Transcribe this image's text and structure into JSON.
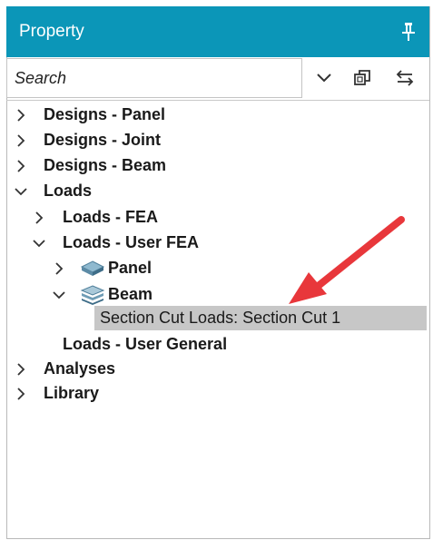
{
  "panel": {
    "title": "Property"
  },
  "toolbar": {
    "search_placeholder": "Search",
    "dropdown_icon": "chevron-down-icon",
    "copy_icon": "copy-windows-icon",
    "swap_icon": "swap-arrows-icon",
    "pin_icon": "pin-icon"
  },
  "tree": {
    "designs_panel": "Designs - Panel",
    "designs_joint": "Designs - Joint",
    "designs_beam": "Designs - Beam",
    "loads": "Loads",
    "loads_fea": "Loads - FEA",
    "loads_user_fea": "Loads - User FEA",
    "panel": "Panel",
    "beam": "Beam",
    "section_cut": "Section Cut Loads: Section Cut 1",
    "loads_user_general": "Loads - User General",
    "analyses": "Analyses",
    "library": "Library"
  },
  "colors": {
    "header": "#0b96b8",
    "selection": "#c7c7c7",
    "arrow": "#e8373b"
  }
}
